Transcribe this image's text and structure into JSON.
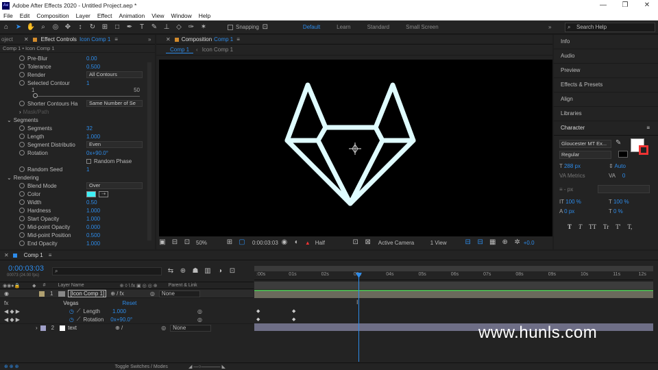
{
  "titlebar": {
    "app_badge": "Ae",
    "title": "Adobe After Effects 2020 - Untitled Project.aep *"
  },
  "menu": [
    "File",
    "Edit",
    "Composition",
    "Layer",
    "Effect",
    "Animation",
    "View",
    "Window",
    "Help"
  ],
  "toolbar": {
    "snapping": "Snapping",
    "workspaces": [
      "Default",
      "Learn",
      "Standard",
      "Small Screen"
    ],
    "search_placeholder": "Search Help"
  },
  "effect_controls": {
    "project_tab": "oject",
    "tab_label": "Effect Controls",
    "tab_layer": "Icon Comp 1",
    "breadcrumb": "Comp 1 • Icon Comp 1",
    "rows": [
      {
        "label": "Pre-Blur",
        "value": "0.00"
      },
      {
        "label": "Tolerance",
        "value": "0.500"
      },
      {
        "label": "Render",
        "dropdown": "All Contours"
      },
      {
        "label": "Selected Contour",
        "value": "1"
      },
      {
        "label": "Shorter Contours Ha",
        "dropdown": "Same Number of Se"
      },
      {
        "label": "Mask/Path"
      },
      {
        "label": "Segments",
        "section": true
      },
      {
        "label": "Segments",
        "value": "32"
      },
      {
        "label": "Length",
        "value": "1.000"
      },
      {
        "label": "Segment Distributio",
        "dropdown": "Even"
      },
      {
        "label": "Rotation",
        "value": "0x+90.0°"
      },
      {
        "label": "Random Phase",
        "checkbox": true
      },
      {
        "label": "Random Seed",
        "value": "1"
      },
      {
        "label": "Rendering",
        "section": true
      },
      {
        "label": "Blend Mode",
        "dropdown": "Over"
      },
      {
        "label": "Color",
        "swatch": "#3ff0f5"
      },
      {
        "label": "Width",
        "value": "0.50"
      },
      {
        "label": "Hardness",
        "value": "1.000"
      },
      {
        "label": "Start Opacity",
        "value": "1.000"
      },
      {
        "label": "Mid-point Opacity",
        "value": "0.000"
      },
      {
        "label": "Mid-point Position",
        "value": "0.500"
      },
      {
        "label": "End Opacity",
        "value": "1.000"
      }
    ],
    "slider": {
      "min": "1",
      "max": "50"
    }
  },
  "composition": {
    "panel_label": "Composition",
    "panel_comp": "Comp 1",
    "tabs": [
      "Comp 1",
      "Icon Comp 1"
    ],
    "zoom": "50%",
    "timecode": "0:00:03:03",
    "resolution": "Half",
    "camera": "Active Camera",
    "view": "1 View",
    "exposure": "+0.0"
  },
  "right_panels": {
    "items": [
      "Info",
      "Audio",
      "Preview",
      "Effects & Presets",
      "Align",
      "Libraries"
    ],
    "character": "Character",
    "font": "Gloucester MT Ex...",
    "style": "Regular",
    "size": "288 px",
    "leading": "Auto",
    "kerning": "Metrics",
    "tracking": "0",
    "stroke_unit": "- px",
    "vscale": "100 %",
    "hscale": "100 %",
    "baseline": "0 px",
    "tsume": "0 %",
    "text_styles": [
      "T",
      "T",
      "TT",
      "Tr",
      "T'",
      "T,"
    ]
  },
  "timeline": {
    "tab": "Comp 1",
    "timecode": "0:00:03:03",
    "frames": "00073 (24.00 fps)",
    "headers": {
      "num": "#",
      "layer_name": "Layer Name",
      "parent": "Parent & Link"
    },
    "layers": [
      {
        "num": "1",
        "name": "[Icon Comp 1]",
        "parent": "None"
      },
      {
        "effect": "Vegas",
        "reset": "Reset"
      },
      {
        "prop": "Length",
        "value": "1.000"
      },
      {
        "prop": "Rotation",
        "value": "0x+90.0°"
      },
      {
        "num": "2",
        "name": "text",
        "parent": "None"
      }
    ],
    "ruler": [
      ":00s",
      "01s",
      "02s",
      "03s",
      "04s",
      "05s",
      "06s",
      "07s",
      "08s",
      "09s",
      "10s",
      "11s",
      "12s"
    ],
    "footer": "Toggle Switches / Modes"
  },
  "watermark": "www.hunls.com",
  "colors": {
    "accent": "#2d8ceb",
    "logo_stroke": "#dffcff",
    "swatch": "#3ff0f5"
  }
}
